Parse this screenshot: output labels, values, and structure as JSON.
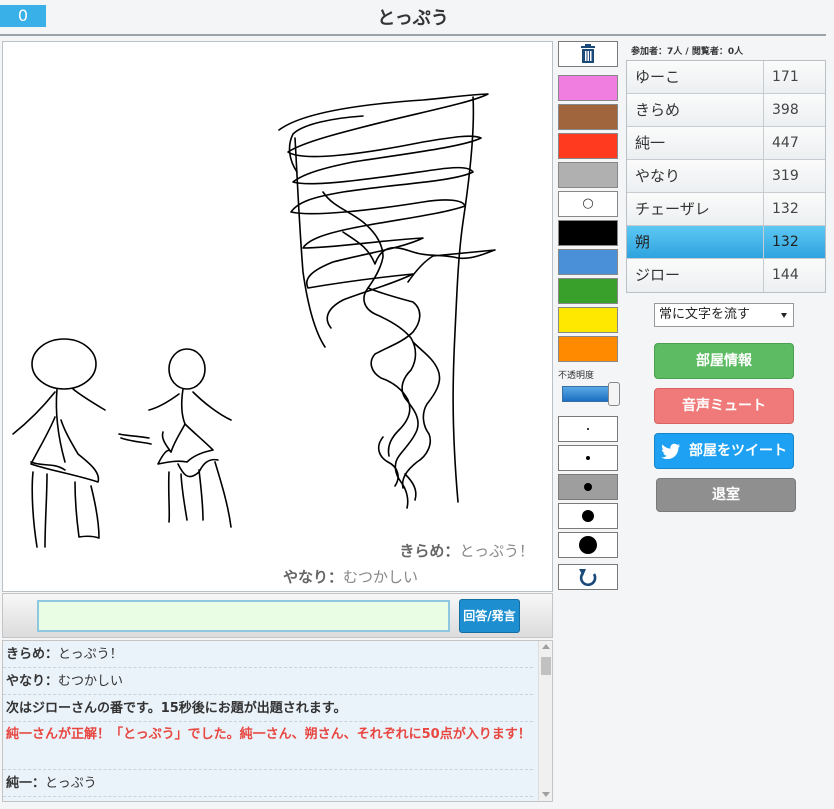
{
  "header": {
    "timer": "0",
    "title": "とっぷう"
  },
  "canvas": {
    "messages": [
      {
        "name": "きらめ：",
        "text": "とっぷう！"
      },
      {
        "name": "やなり：",
        "text": "むつかしい"
      }
    ]
  },
  "input": {
    "value": "",
    "submit_label": "回答/発言"
  },
  "chat": {
    "lines": [
      {
        "name": "きらめ：",
        "text": "とっぷう！"
      },
      {
        "name": "やなり：",
        "text": "むつかしい"
      },
      {
        "text": "次はジローさんの番です。15秒後にお題が出題されます。"
      },
      {
        "text": "純一さんが正解！「とっぷう」でした。純一さん、朔さん、それぞれに50点が入ります！"
      },
      {
        "name": "純一：",
        "text": "とっぷう"
      }
    ]
  },
  "tools": {
    "colors": [
      "#f07ee0",
      "#a0653d",
      "#ff3a1f",
      "#b0b0b0",
      "#ffffff",
      "#000000",
      "#4a90d9",
      "#3aa02c",
      "#ffe800",
      "#ff8a00"
    ],
    "white_label": "○",
    "opacity_label": "不透明度",
    "opacity": 1.0,
    "sizes_selected": 2
  },
  "room": {
    "stats": "参加者：7人 / 閲覧者：0人",
    "players": [
      {
        "name": "ゆーこ",
        "score": "171"
      },
      {
        "name": "きらめ",
        "score": "398"
      },
      {
        "name": "純一",
        "score": "447"
      },
      {
        "name": "やなり",
        "score": "319"
      },
      {
        "name": "チェーザレ",
        "score": "132"
      },
      {
        "name": "朔",
        "score": "132",
        "active": true
      },
      {
        "name": "ジロー",
        "score": "144"
      }
    ],
    "stream_option": "常に文字を流す",
    "buttons": {
      "info": "部屋情報",
      "mute": "音声ミュート",
      "tweet": "部屋をツイート",
      "exit": "退室"
    }
  }
}
